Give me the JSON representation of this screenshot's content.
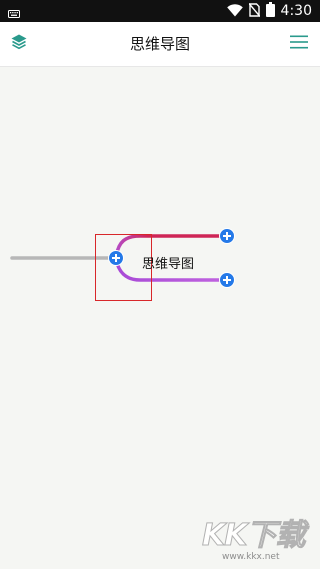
{
  "status_bar": {
    "time": "4:30",
    "icons": [
      "keyboard-icon",
      "wifi-icon",
      "sim-off-icon",
      "battery-icon"
    ]
  },
  "app_bar": {
    "title": "思维导图",
    "left_icon": "layers-icon",
    "right_icon": "menu-icon"
  },
  "mind_map": {
    "central_node": "思维导图",
    "branch_colors": [
      "#cf2556",
      "#b35ad8"
    ],
    "root_line_color": "#b7b7b7",
    "selection_color": "#d8272a",
    "add_button_color": "#2479e8"
  },
  "watermark": {
    "logo_text": "KK下载",
    "url": "www.kkx.net"
  }
}
